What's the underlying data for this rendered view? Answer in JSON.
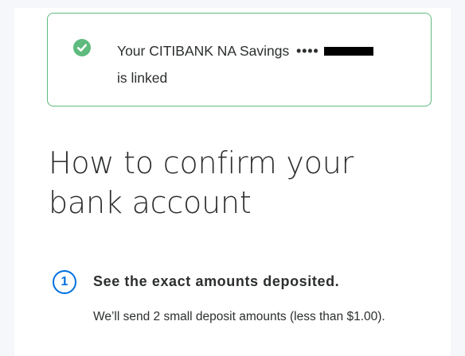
{
  "banner": {
    "text_prefix": "Your CITIBANK NA Savings",
    "masked_account": "••••",
    "text_suffix": "is linked",
    "icon": "check-circle-icon"
  },
  "heading": {
    "line1": "How to confirm your",
    "line2": "bank account"
  },
  "steps": [
    {
      "number": "1",
      "title": "See the exact amounts deposited.",
      "description": "We’ll send 2 small deposit amounts (less than $1.00)."
    }
  ],
  "colors": {
    "success_green": "#5fba7d",
    "accent_blue": "#0070e0",
    "text": "#2c2e2f"
  }
}
